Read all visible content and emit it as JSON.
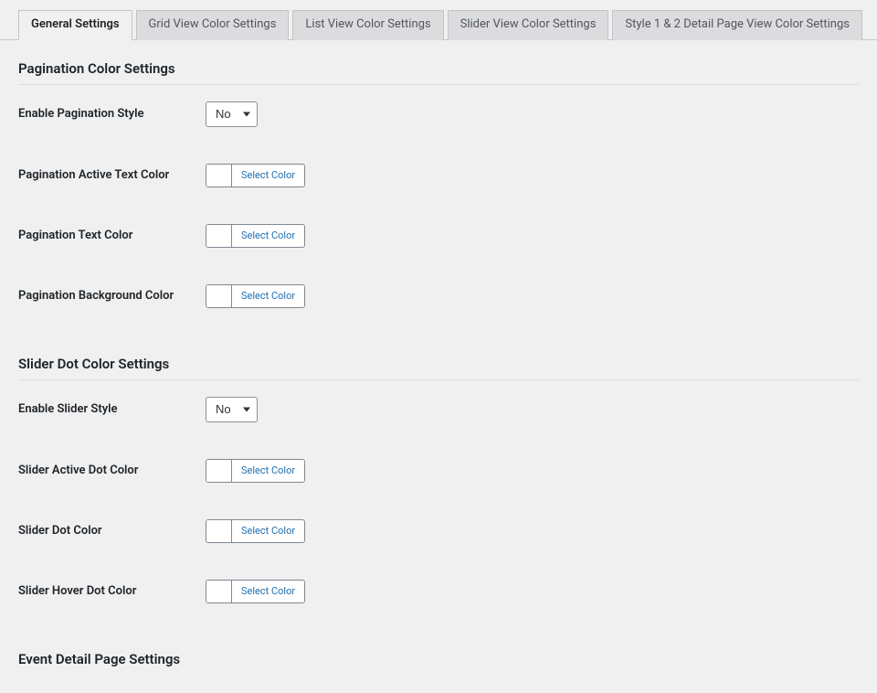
{
  "tabs": [
    {
      "label": "General Settings",
      "active": true
    },
    {
      "label": "Grid View Color Settings",
      "active": false
    },
    {
      "label": "List View Color Settings",
      "active": false
    },
    {
      "label": "Slider View Color Settings",
      "active": false
    },
    {
      "label": "Style 1 & 2 Detail Page View Color Settings",
      "active": false
    }
  ],
  "sections": {
    "pagination": {
      "title": "Pagination Color Settings",
      "enable_label": "Enable Pagination Style",
      "enable_value": "No",
      "active_text_label": "Pagination Active Text Color",
      "text_label": "Pagination Text Color",
      "bg_label": "Pagination Background Color"
    },
    "slider": {
      "title": "Slider Dot Color Settings",
      "enable_label": "Enable Slider Style",
      "enable_value": "No",
      "active_dot_label": "Slider Active Dot Color",
      "dot_label": "Slider Dot Color",
      "hover_dot_label": "Slider Hover Dot Color"
    },
    "event_detail": {
      "title": "Event Detail Page Settings"
    }
  },
  "common": {
    "select_color": "Select Color"
  }
}
